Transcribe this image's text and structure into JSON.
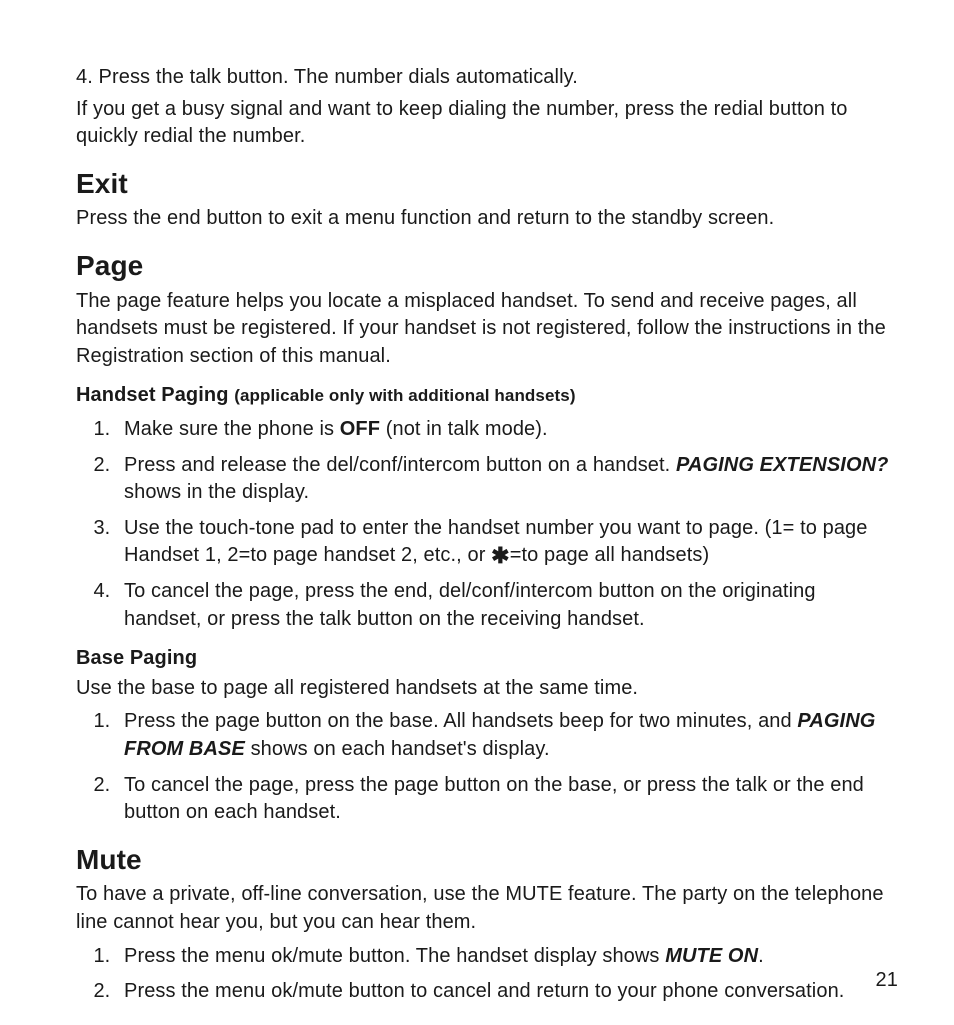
{
  "intro": {
    "step4": "4. Press the talk button. The number dials automatically.",
    "busy": "If you get a busy signal and want to keep dialing the number, press the redial button to quickly redial the number."
  },
  "exit": {
    "title": "Exit",
    "body": "Press the end button to exit a menu function and return to the standby screen."
  },
  "page_section": {
    "title": "Page",
    "intro": "The page feature helps you locate a misplaced handset. To send and receive pages, all handsets must be registered. If your handset is not registered, follow the instructions in the Registration section of this manual.",
    "handset_paging": {
      "title_main": "Handset Paging ",
      "title_sub": "(applicable only with additional handsets)",
      "s1_a": "Make sure the phone is ",
      "s1_off": "OFF",
      "s1_b": " (not in talk mode).",
      "s2_a": "Press and release the del/conf/intercom button on a handset. ",
      "s2_pe": "PAGING EXTENSION?",
      "s2_b": " shows in the display.",
      "s3_a": "Use the touch-tone pad to enter the handset number you want to page. (1= to page Handset 1, 2=to page handset 2, etc., or ",
      "s3_star": "✱",
      "s3_b": "=to page all handsets)",
      "s4": "To cancel the page, press the end, del/conf/intercom button on the originating handset, or press the talk button on the receiving handset."
    },
    "base_paging": {
      "title": "Base Paging",
      "intro": "Use the base to page all registered handsets at the same time.",
      "s1_a": "Press the page button on the base. All handsets beep for two minutes, and ",
      "s1_pfb": "PAGING FROM BASE",
      "s1_b": " shows on each handset's display.",
      "s2": "To cancel the page, press the page button on the base, or press the talk or the end button on each handset."
    }
  },
  "mute": {
    "title": "Mute",
    "intro": "To have a private, off-line conversation, use the MUTE feature. The party on the telephone line cannot hear you, but you can hear them.",
    "s1_a": "Press the menu ok/mute button. The handset display shows ",
    "s1_mo": "MUTE ON",
    "s1_b": ".",
    "s2": "Press the menu ok/mute button to cancel and return to your phone conversation."
  },
  "page_number": "21"
}
